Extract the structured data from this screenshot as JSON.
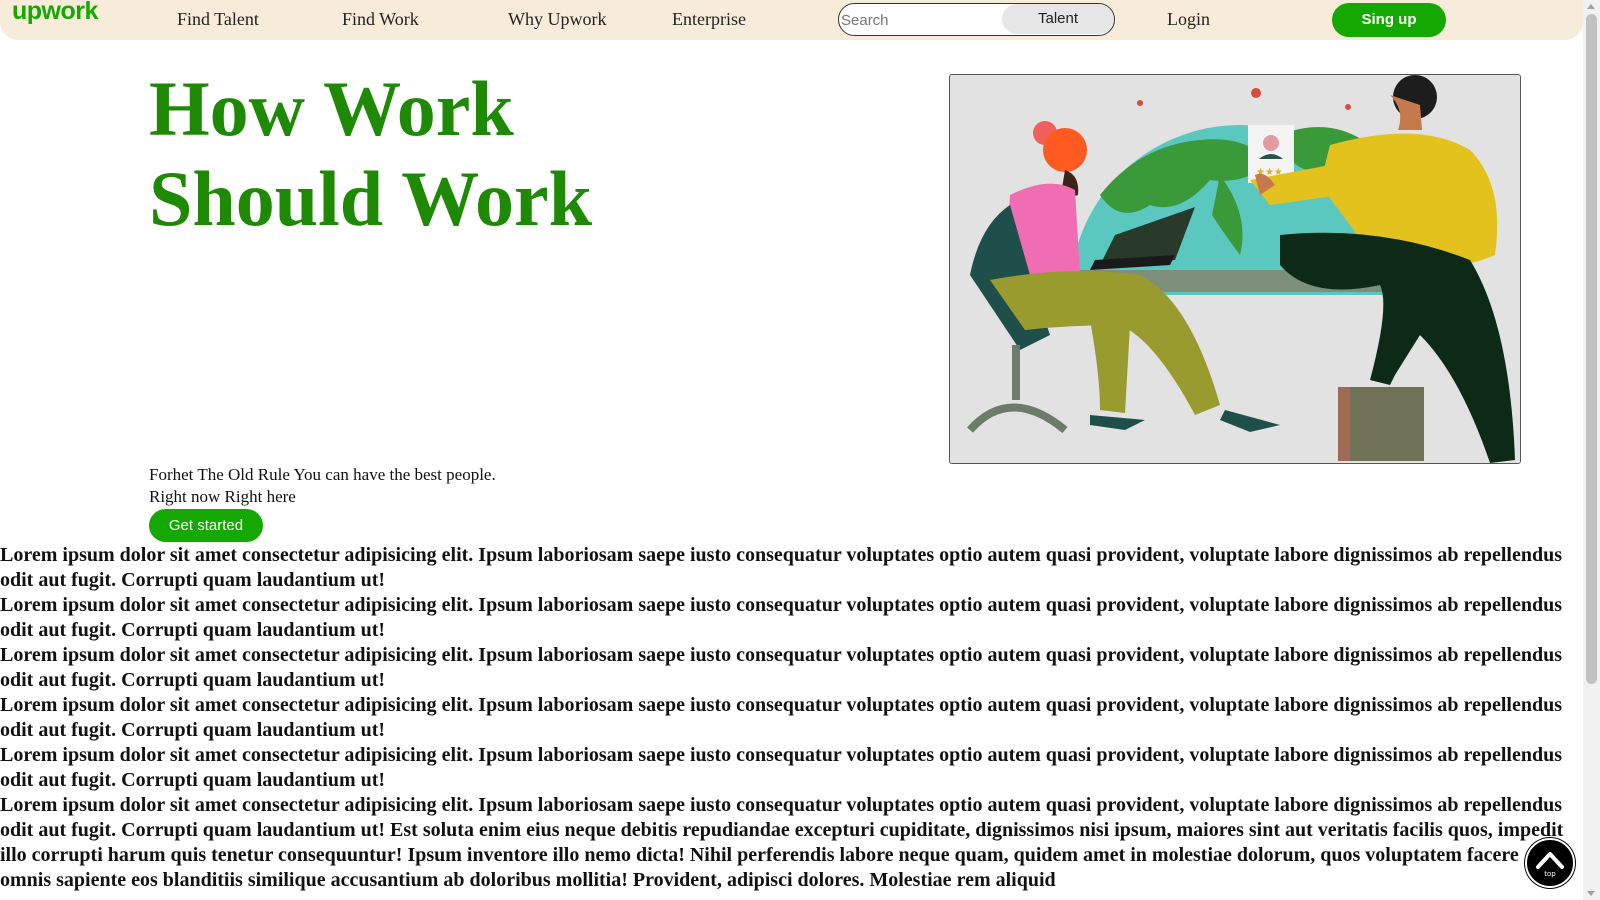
{
  "nav": {
    "logo": "upwork",
    "links": [
      "Find Talent",
      "Find Work",
      "Why Upwork",
      "Enterprise"
    ],
    "search_placeholder": "Search",
    "search_scope": "Talent",
    "login": "Login",
    "signup": "Sing up"
  },
  "hero": {
    "title_line1": "How Work",
    "title_line2": "Should Work",
    "subtitle_line1": "Forhet The Old Rule You can have the best people.",
    "subtitle_line2": "Right now Right here",
    "cta": "Get started"
  },
  "content": {
    "paragraphs": [
      "Lorem ipsum dolor sit amet consectetur adipisicing elit. Ipsum laboriosam saepe iusto consequatur voluptates optio autem quasi provident, voluptate labore dignissimos ab repellendus odit aut fugit. Corrupti quam laudantium ut!",
      "Lorem ipsum dolor sit amet consectetur adipisicing elit. Ipsum laboriosam saepe iusto consequatur voluptates optio autem quasi provident, voluptate labore dignissimos ab repellendus odit aut fugit. Corrupti quam laudantium ut!",
      "Lorem ipsum dolor sit amet consectetur adipisicing elit. Ipsum laboriosam saepe iusto consequatur voluptates optio autem quasi provident, voluptate labore dignissimos ab repellendus odit aut fugit. Corrupti quam laudantium ut!",
      "Lorem ipsum dolor sit amet consectetur adipisicing elit. Ipsum laboriosam saepe iusto consequatur voluptates optio autem quasi provident, voluptate labore dignissimos ab repellendus odit aut fugit. Corrupti quam laudantium ut!",
      "Lorem ipsum dolor sit amet consectetur adipisicing elit. Ipsum laboriosam saepe iusto consequatur voluptates optio autem quasi provident, voluptate labore dignissimos ab repellendus odit aut fugit. Corrupti quam laudantium ut!",
      "Lorem ipsum dolor sit amet consectetur adipisicing elit. Ipsum laboriosam saepe iusto consequatur voluptates optio autem quasi provident, voluptate labore dignissimos ab repellendus odit aut fugit. Corrupti quam laudantium ut! Est soluta enim eius neque debitis repudiandae excepturi cupiditate, dignissimos nisi ipsum, maiores sint aut veritatis facilis quos, impedit illo corrupti harum quis tenetur consequuntur! Ipsum inventore illo nemo dicta! Nihil perferendis labore neque quam, quidem amet in molestiae dolorum, quos voluptatem facere omnis sapiente eos blanditiis similique accusantium ab doloribus mollitia! Provident, adipisci dolores. Molestiae rem aliquid"
    ]
  },
  "back_to_top": {
    "label": "top",
    "icon": "chevron-up-icon"
  },
  "colors": {
    "brand_green": "#14a800",
    "title_green": "#1e8a04",
    "nav_bg": "#f7ecd9"
  }
}
